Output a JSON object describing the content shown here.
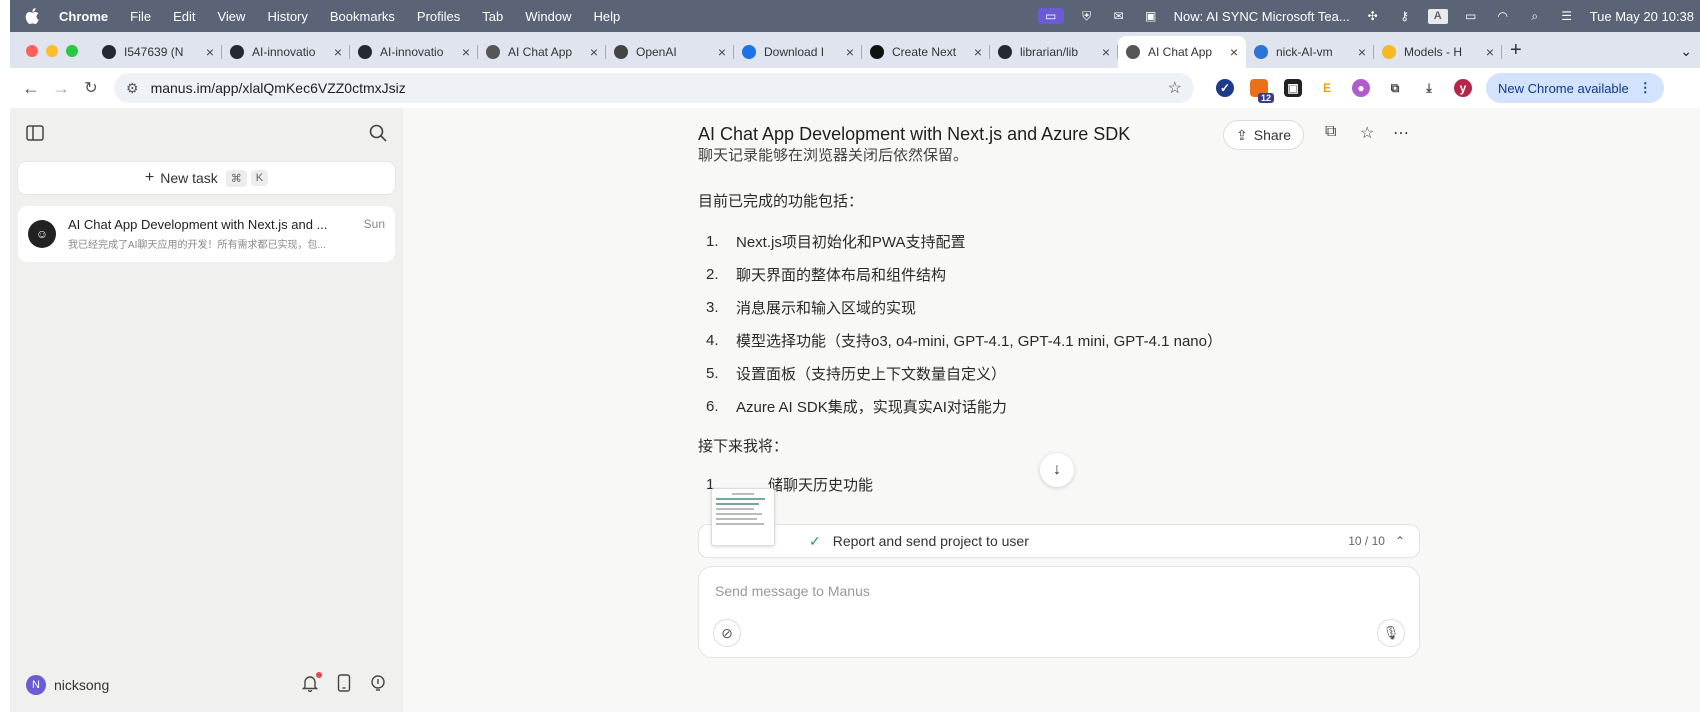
{
  "menubar": {
    "app": "Chrome",
    "items": [
      "File",
      "Edit",
      "View",
      "History",
      "Bookmarks",
      "Profiles",
      "Tab",
      "Window",
      "Help"
    ],
    "notification": "Now: AI SYNC Microsoft Tea...",
    "input_source": "A",
    "datetime": "Tue May 20 10:38"
  },
  "tabs": [
    {
      "title": "I547639 (N",
      "favicon": "github-icon",
      "color": "#24292f"
    },
    {
      "title": "AI-innovatio",
      "favicon": "github-icon",
      "color": "#24292f"
    },
    {
      "title": "AI-innovatio",
      "favicon": "github-icon",
      "color": "#24292f"
    },
    {
      "title": "AI Chat App",
      "favicon": "manus-icon",
      "color": "#555555"
    },
    {
      "title": "OpenAI",
      "favicon": "openai-icon",
      "color": "#444444"
    },
    {
      "title": "Download I",
      "favicon": "download-icon",
      "color": "#1a73e8"
    },
    {
      "title": "Create Next",
      "favicon": "nextjs-icon",
      "color": "#111111"
    },
    {
      "title": "librarian/lib",
      "favicon": "github-icon",
      "color": "#24292f"
    },
    {
      "title": "AI Chat App",
      "favicon": "manus-icon",
      "color": "#555555",
      "active": true
    },
    {
      "title": "nick-AI-vm",
      "favicon": "azure-icon",
      "color": "#2a74d6"
    },
    {
      "title": "Models - H",
      "favicon": "huggingface-icon",
      "color": "#f5b921"
    }
  ],
  "toolbar": {
    "url": "manus.im/app/xlalQmKec6VZZ0ctmxJsiz",
    "extension_badge": "12",
    "profile_initial": "y",
    "update_label": "New Chrome available"
  },
  "sidebar": {
    "new_task_label": "New task",
    "shortcut_symbol": "⌘",
    "shortcut_key": "K",
    "task": {
      "title": "AI Chat App Development with Next.js and ...",
      "day": "Sun",
      "preview": "我已经完成了AI聊天应用的开发！所有需求都已实现，包..."
    },
    "user": {
      "initial": "N",
      "name": "nicksong"
    }
  },
  "chat": {
    "title": "AI Chat App Development with Next.js and Azure SDK",
    "share_label": "Share",
    "cut_line": "聊天记录能够在浏览器关闭后依然保留。",
    "completed_heading": "目前已完成的功能包括：",
    "completed_items": [
      {
        "num": "1.",
        "text": "Next.js项目初始化和PWA支持配置"
      },
      {
        "num": "2.",
        "text": "聊天界面的整体布局和组件结构"
      },
      {
        "num": "3.",
        "text": "消息展示和输入区域的实现"
      },
      {
        "num": "4.",
        "text": "模型选择功能（支持o3, o4-mini, GPT-4.1, GPT-4.1 mini, GPT-4.1 nano）"
      },
      {
        "num": "5.",
        "text": "设置面板（支持历史上下文数量自定义）"
      },
      {
        "num": "6.",
        "text": "Azure AI SDK集成，实现真实AI对话能力"
      }
    ],
    "next_heading": "接下来我将：",
    "next_item_partial": "储聊天历史功能",
    "progress_label": "Report and send project to user",
    "progress_count": "10 / 10",
    "composer_placeholder": "Send message to Manus"
  }
}
